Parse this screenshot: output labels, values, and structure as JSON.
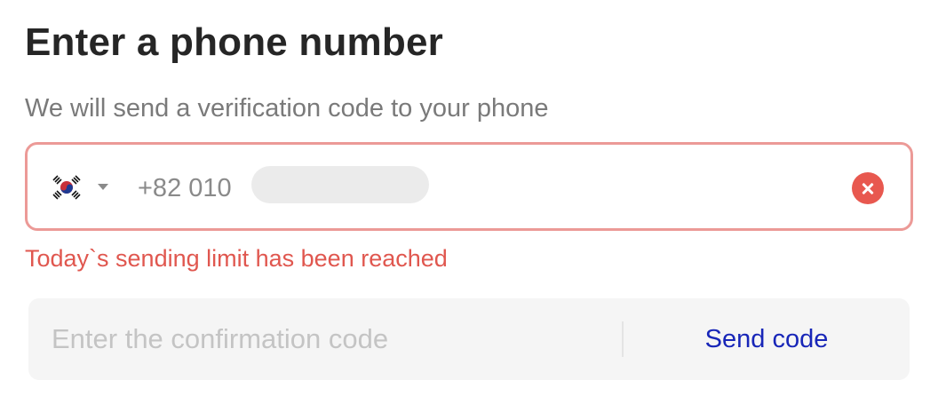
{
  "header": {
    "title": "Enter a phone number",
    "subtitle": "We will send a verification code to your phone"
  },
  "phone_field": {
    "country_flag_icon": "south-korea-flag-icon",
    "dropdown_icon": "caret-down-icon",
    "prefix": "+82 010",
    "number_redacted": true,
    "clear_icon": "close-circle-icon",
    "border_color": "#ec9a97"
  },
  "error": {
    "message": "Today`s sending limit has been reached",
    "color": "#e0574f"
  },
  "confirmation": {
    "placeholder": "Enter the confirmation code",
    "value": "",
    "send_label": "Send code",
    "send_color": "#1826b8"
  }
}
